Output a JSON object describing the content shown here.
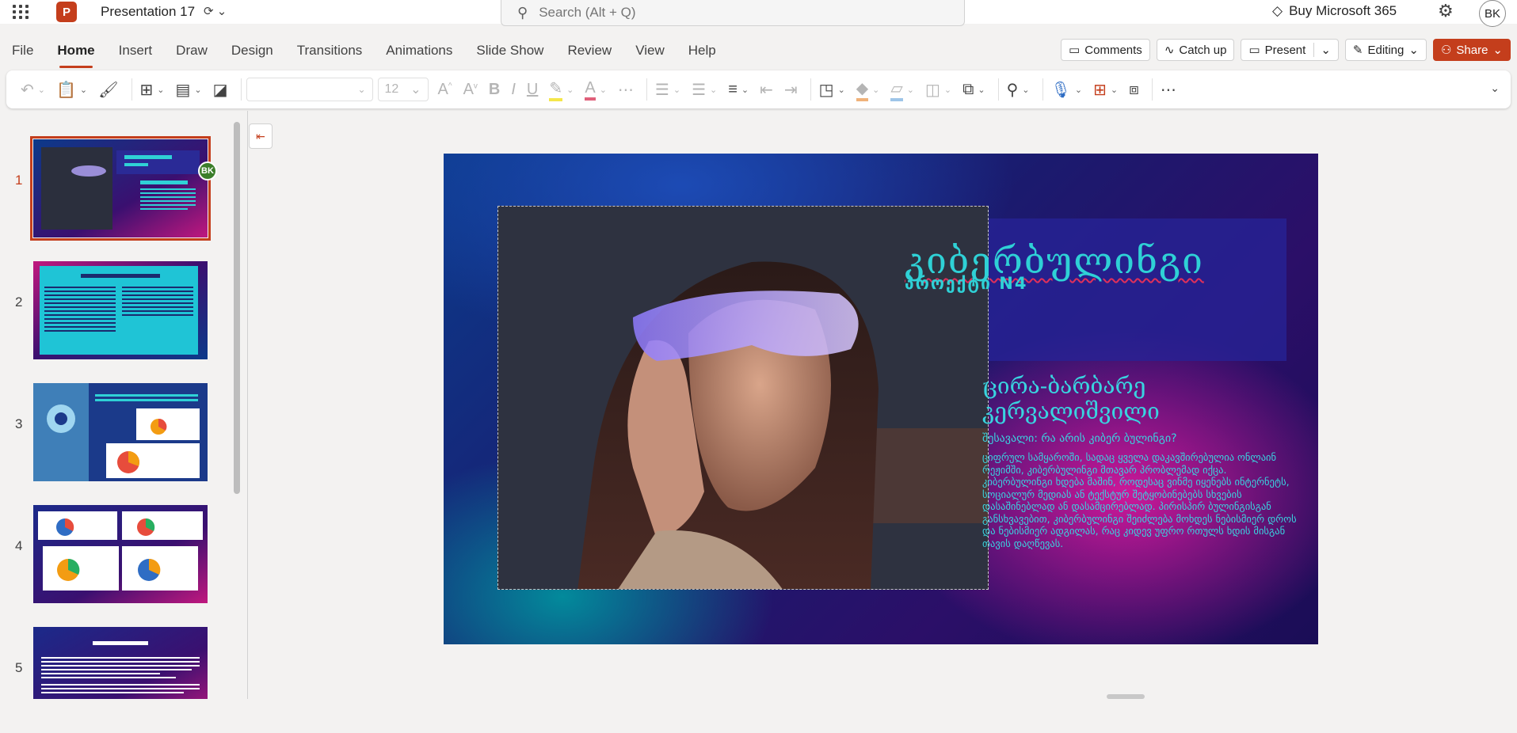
{
  "app": {
    "title": "Presentation 17",
    "logo_letter": "P",
    "search_placeholder": "Search (Alt + Q)",
    "buy_label": "Buy Microsoft 365",
    "user_initials": "BK"
  },
  "tabs": [
    "File",
    "Home",
    "Insert",
    "Draw",
    "Design",
    "Transitions",
    "Animations",
    "Slide Show",
    "Review",
    "View",
    "Help"
  ],
  "actions": {
    "comments": "Comments",
    "catchup": "Catch up",
    "present": "Present",
    "editing": "Editing",
    "share": "Share"
  },
  "toolbar": {
    "font_size": "12"
  },
  "thumbnails": [
    {
      "num": "1"
    },
    {
      "num": "2"
    },
    {
      "num": "3"
    },
    {
      "num": "4"
    },
    {
      "num": "5"
    }
  ],
  "presence_badge": "BK",
  "slide": {
    "title": "კიბერბულინგი",
    "subtitle": "პროექტი N4",
    "author": "ცირა-ბარბარე კერვალიშვილი",
    "question": "შესავალი: რა არის კიბერ ბულინგი?",
    "body": "ციფრულ სამყაროში, სადაც ყველა დაკავშირებულია ონლაინ რეჟიმში, კიბერბულინგი მთავარ პრობლემად იქცა. კიბერბულინგი ხდება მაშინ, როდესაც ვინმე იყენებს ინტერნეტს, სოციალურ მედიას ან ტექსტურ შეტყობინებებს სხვების დასაშინებლად ან დასამცირებლად. პირისპირ ბულინგისგან განსხვავებით, კიბერბულინგი შეიძლება მოხდეს ნებისმიერ დროს და ნებისმიერ ადგილას, რაც კიდევ უფრო რთულს ხდის მისგან თავის დაღწევას."
  },
  "colors": {
    "accent": "#c43e1c",
    "slide_text": "#2fd1d6"
  }
}
